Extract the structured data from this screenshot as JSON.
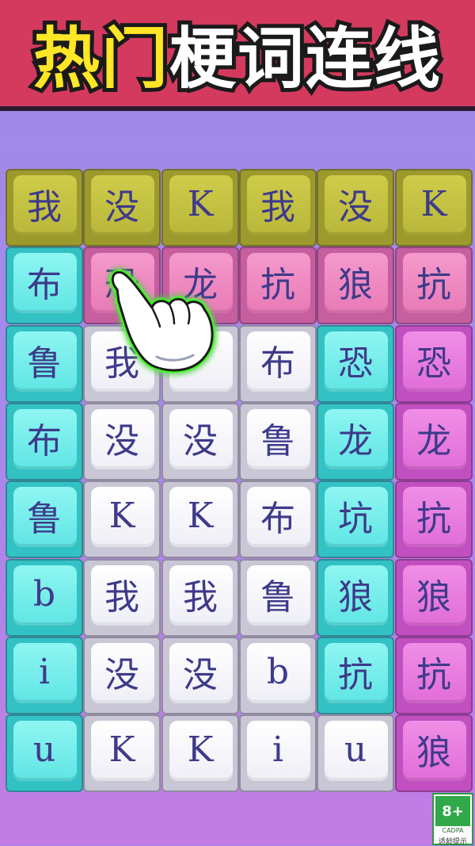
{
  "banner": {
    "title_part1": "热门",
    "title_part2": "梗词连线",
    "colors": {
      "background": "#d43a5e",
      "part1": "#ffe627",
      "part2": "#ffffff"
    }
  },
  "board": {
    "rows": [
      [
        {
          "ch": "我",
          "color": "olive"
        },
        {
          "ch": "没",
          "color": "olive"
        },
        {
          "ch": "K",
          "color": "olive"
        },
        {
          "ch": "我",
          "color": "olive"
        },
        {
          "ch": "没",
          "color": "olive"
        },
        {
          "ch": "K",
          "color": "olive"
        }
      ],
      [
        {
          "ch": "布",
          "color": "cyan"
        },
        {
          "ch": "恐",
          "color": "pink"
        },
        {
          "ch": "龙",
          "color": "pink"
        },
        {
          "ch": "抗",
          "color": "pink"
        },
        {
          "ch": "狼",
          "color": "pink"
        },
        {
          "ch": "抗",
          "color": "pink"
        }
      ],
      [
        {
          "ch": "鲁",
          "color": "cyan"
        },
        {
          "ch": "我",
          "color": "white"
        },
        {
          "ch": "",
          "color": "white"
        },
        {
          "ch": "布",
          "color": "white"
        },
        {
          "ch": "恐",
          "color": "cyan"
        },
        {
          "ch": "恐",
          "color": "magenta"
        }
      ],
      [
        {
          "ch": "布",
          "color": "cyan"
        },
        {
          "ch": "没",
          "color": "white"
        },
        {
          "ch": "没",
          "color": "white"
        },
        {
          "ch": "鲁",
          "color": "white"
        },
        {
          "ch": "龙",
          "color": "cyan"
        },
        {
          "ch": "龙",
          "color": "magenta"
        }
      ],
      [
        {
          "ch": "鲁",
          "color": "cyan"
        },
        {
          "ch": "K",
          "color": "white"
        },
        {
          "ch": "K",
          "color": "white"
        },
        {
          "ch": "布",
          "color": "white"
        },
        {
          "ch": "坑",
          "color": "cyan"
        },
        {
          "ch": "抗",
          "color": "magenta"
        }
      ],
      [
        {
          "ch": "b",
          "color": "cyan"
        },
        {
          "ch": "我",
          "color": "white"
        },
        {
          "ch": "我",
          "color": "white"
        },
        {
          "ch": "鲁",
          "color": "white"
        },
        {
          "ch": "狼",
          "color": "cyan"
        },
        {
          "ch": "狼",
          "color": "magenta"
        }
      ],
      [
        {
          "ch": "i",
          "color": "cyan"
        },
        {
          "ch": "没",
          "color": "white"
        },
        {
          "ch": "没",
          "color": "white"
        },
        {
          "ch": "b",
          "color": "white"
        },
        {
          "ch": "抗",
          "color": "cyan"
        },
        {
          "ch": "抗",
          "color": "magenta"
        }
      ],
      [
        {
          "ch": "u",
          "color": "cyan"
        },
        {
          "ch": "K",
          "color": "white"
        },
        {
          "ch": "K",
          "color": "white"
        },
        {
          "ch": "i",
          "color": "white"
        },
        {
          "ch": "u",
          "color": "white"
        },
        {
          "ch": "狼",
          "color": "magenta"
        }
      ]
    ]
  },
  "pointer": {
    "icon": "pointing-hand-icon",
    "glow_color": "#39ff14"
  },
  "age_rating": {
    "age": "8+",
    "org": "CADPA",
    "tip": "适龄提示",
    "color": "#31a84a"
  }
}
